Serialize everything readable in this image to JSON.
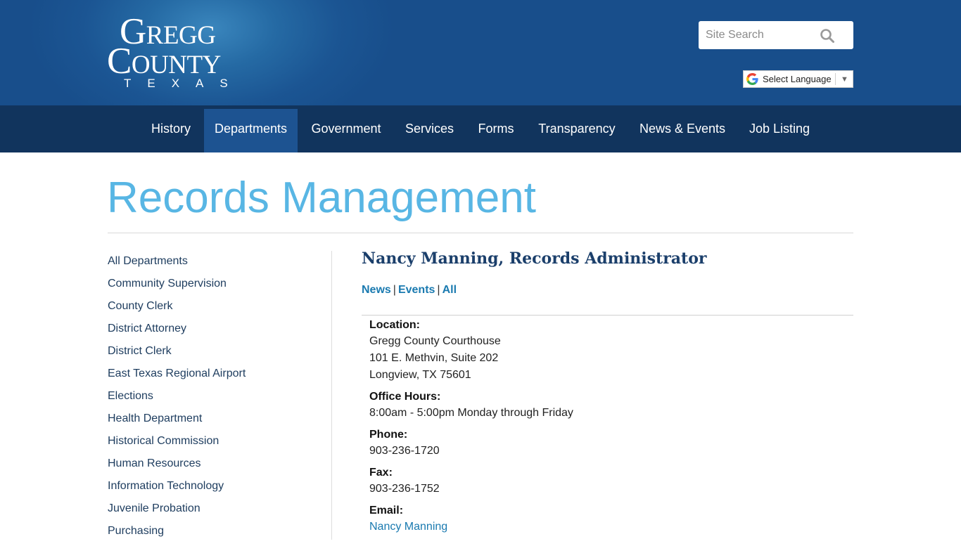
{
  "header": {
    "logo": {
      "line1": "Gregg",
      "line2": "County",
      "line3": "TEXAS"
    },
    "search": {
      "placeholder": "Site Search"
    },
    "language": {
      "label": "Select Language",
      "arrow": "▼"
    }
  },
  "nav": {
    "items": [
      {
        "label": "History"
      },
      {
        "label": "Departments",
        "active": true
      },
      {
        "label": "Government"
      },
      {
        "label": "Services"
      },
      {
        "label": "Forms"
      },
      {
        "label": "Transparency"
      },
      {
        "label": "News & Events"
      },
      {
        "label": "Job Listing"
      }
    ]
  },
  "page": {
    "title": "Records Management"
  },
  "sidebar": {
    "items": [
      {
        "label": "All Departments"
      },
      {
        "label": "Community Supervision"
      },
      {
        "label": "County Clerk"
      },
      {
        "label": "District Attorney"
      },
      {
        "label": "District Clerk"
      },
      {
        "label": "East Texas Regional Airport"
      },
      {
        "label": "Elections"
      },
      {
        "label": "Health Department"
      },
      {
        "label": "Historical Commission"
      },
      {
        "label": "Human Resources"
      },
      {
        "label": "Information Technology"
      },
      {
        "label": "Juvenile Probation"
      },
      {
        "label": "Purchasing"
      }
    ]
  },
  "main": {
    "heading": "Nancy Manning, Records Administrator",
    "filters": {
      "news": "News",
      "events": "Events",
      "all": "All",
      "separator": "|"
    },
    "location": {
      "label": "Location:",
      "line1": "Gregg County Courthouse",
      "line2": "101 E. Methvin, Suite 202",
      "line3": "Longview, TX 75601"
    },
    "hours": {
      "label": "Office Hours:",
      "value": "8:00am - 5:00pm Monday through Friday"
    },
    "phone": {
      "label": "Phone:",
      "value": "903-236-1720"
    },
    "fax": {
      "label": "Fax:",
      "value": "903-236-1752"
    },
    "email": {
      "label": "Email:",
      "value": "Nancy Manning"
    }
  },
  "colors": {
    "header_bg": "#184e8b",
    "nav_bg": "#11345d",
    "nav_active_bg": "#1d5391",
    "title_color": "#58b6e4",
    "link_color": "#1a7ab0",
    "heading_color": "#1b3f6b"
  },
  "icons": {
    "search": "search-icon",
    "google": "google-g-icon"
  }
}
